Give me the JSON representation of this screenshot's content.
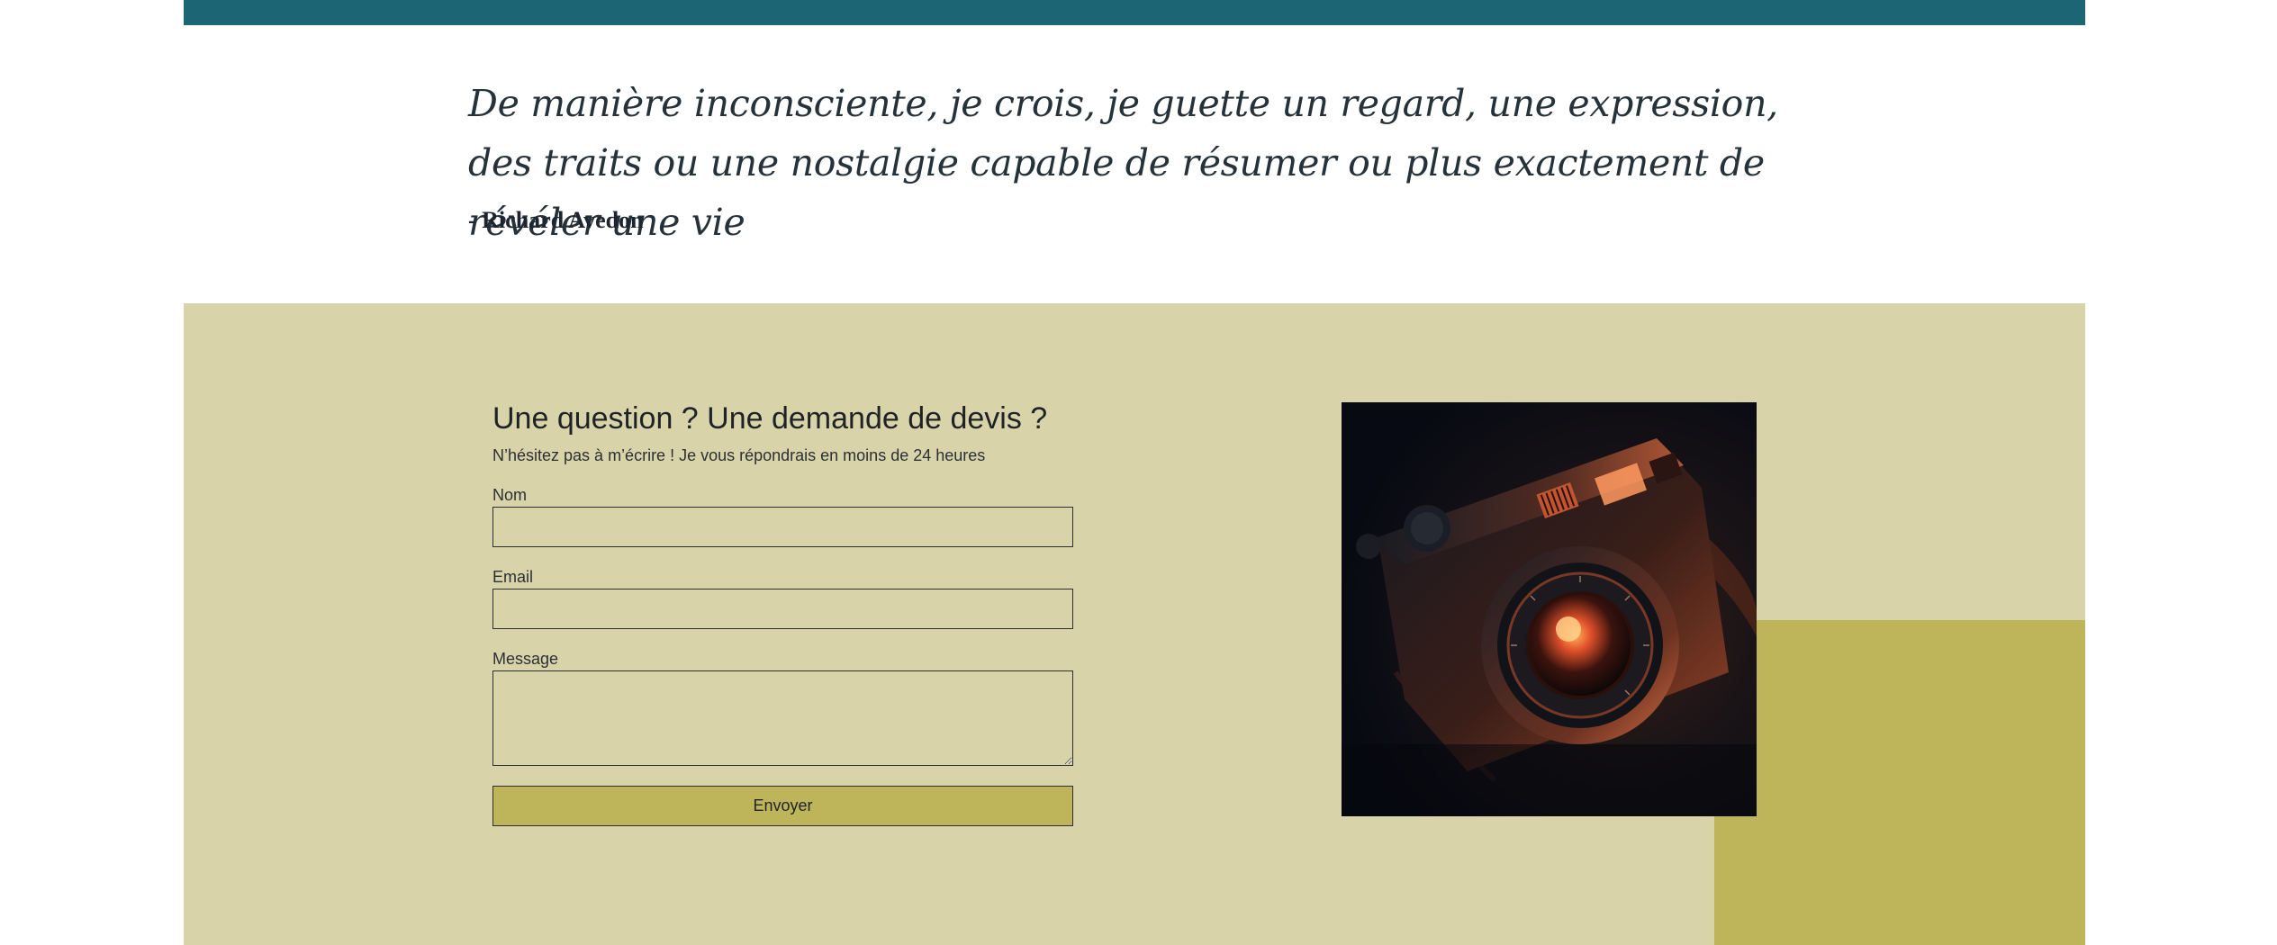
{
  "quote": {
    "text": "De manière inconsciente, je crois, je guette un regard, une expression, des traits ou une nostalgie capable de résumer ou plus exactement de révéler une vie",
    "author": "- Richard Avedon"
  },
  "contact": {
    "title": "Une question ? Une demande de devis ?",
    "subtitle": "N’hésitez pas à m’écrire ! Je vous répondrais en moins de 24 heures",
    "fields": {
      "name_label": "Nom",
      "name_value": "",
      "email_label": "Email",
      "email_value": "",
      "message_label": "Message",
      "message_value": ""
    },
    "submit_label": "Envoyer",
    "photo_icon": "vintage-camera-photo"
  },
  "colors": {
    "top_bar": "#1c6575",
    "contact_background": "#d8d3a8",
    "accent": "#beb55a",
    "text_dark": "#1f2326"
  }
}
